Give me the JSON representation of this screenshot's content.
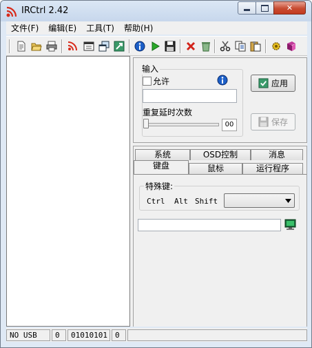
{
  "window": {
    "title": "IRCtrl 2.42"
  },
  "menu": {
    "items": [
      "文件(F)",
      "编辑(E)",
      "工具(T)",
      "帮助(H)"
    ]
  },
  "toolbar": {
    "icons": [
      "new-file-icon",
      "open-folder-icon",
      "print-icon",
      "signal-icon",
      "window-icon",
      "restore-icon",
      "export-icon",
      "info-icon",
      "play-icon",
      "save-icon",
      "delete-icon",
      "recycle-icon",
      "cut-icon",
      "copy-icon",
      "paste-icon",
      "settings-icon",
      "book-icon"
    ]
  },
  "input_group": {
    "label": "输入",
    "allow_label": "允许",
    "allow_checked": false,
    "repeat_label": "重复延时次数",
    "repeat_value": "00",
    "text_value": ""
  },
  "buttons": {
    "apply": "应用",
    "save": "保存"
  },
  "tabs": {
    "row1": [
      "系统",
      "OSD控制",
      "消息"
    ],
    "row2": [
      "键盘",
      "鼠标",
      "运行程序"
    ],
    "active": "键盘"
  },
  "keyboard": {
    "special_label": "特殊键:",
    "ctrl": "Ctrl",
    "alt": "Alt",
    "shift": "Shift",
    "dropdown_value": "",
    "key_input_value": ""
  },
  "status": [
    "NO USB",
    "0",
    "01010101",
    "0"
  ],
  "colors": {
    "title_bg": "#c7d7ec",
    "close_btn": "#c74b31",
    "info_blue": "#1c5fc7",
    "delete_red": "#d2231a"
  }
}
